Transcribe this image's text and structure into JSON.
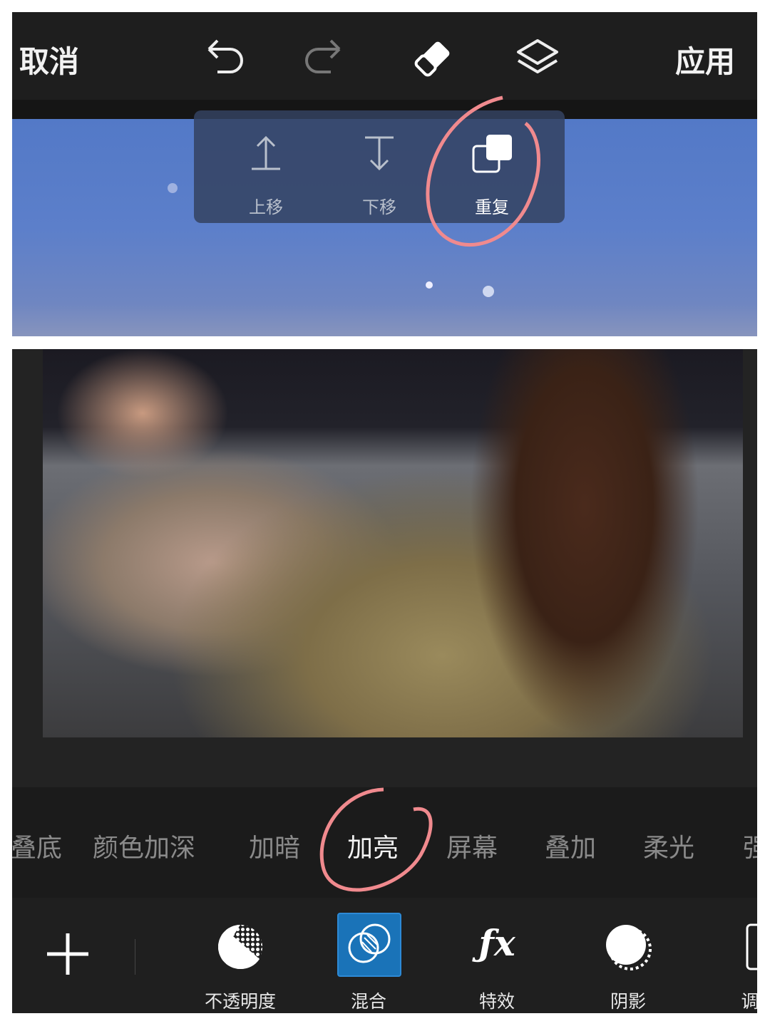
{
  "topbar": {
    "cancel": "取消",
    "apply": "应用",
    "icons": [
      "undo-icon",
      "redo-icon",
      "eraser-icon",
      "layers-icon"
    ]
  },
  "popup": {
    "items": [
      {
        "label": "上移",
        "icon": "move-up-icon"
      },
      {
        "label": "下移",
        "icon": "move-down-icon"
      },
      {
        "label": "重复",
        "icon": "duplicate-icon"
      }
    ]
  },
  "blend_modes": {
    "items": [
      "叠底",
      "颜色加深",
      "加暗",
      "加亮",
      "屏幕",
      "叠加",
      "柔光",
      "强"
    ],
    "selected": "加亮"
  },
  "tools": {
    "items": [
      {
        "label": "不透明度",
        "icon": "opacity-icon"
      },
      {
        "label": "混合",
        "icon": "blend-icon",
        "selected": true
      },
      {
        "label": "特效",
        "icon": "fx-icon"
      },
      {
        "label": "阴影",
        "icon": "shadow-icon"
      },
      {
        "label": "调",
        "icon": "adjust-icon"
      }
    ],
    "add": "add-icon"
  },
  "colors": {
    "accent": "#1a73b8",
    "annotation": "#f08a8e",
    "background": "#1e1e1e"
  }
}
